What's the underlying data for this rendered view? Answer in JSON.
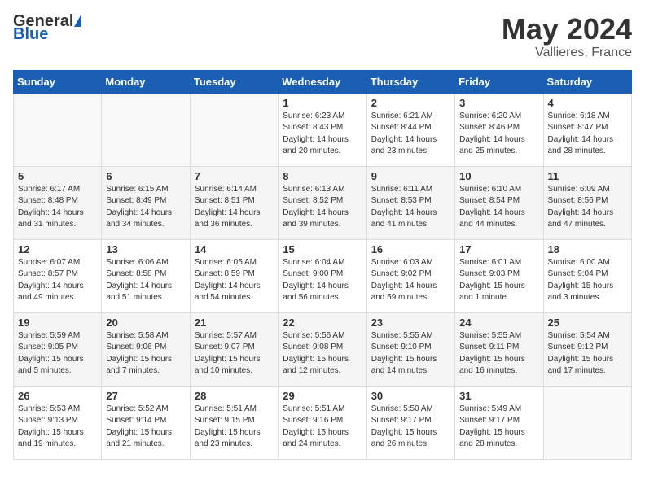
{
  "header": {
    "logo_general": "General",
    "logo_blue": "Blue",
    "title": "May 2024",
    "location": "Vallieres, France"
  },
  "weekdays": [
    "Sunday",
    "Monday",
    "Tuesday",
    "Wednesday",
    "Thursday",
    "Friday",
    "Saturday"
  ],
  "weeks": [
    [
      {
        "day": "",
        "info": ""
      },
      {
        "day": "",
        "info": ""
      },
      {
        "day": "",
        "info": ""
      },
      {
        "day": "1",
        "info": "Sunrise: 6:23 AM\nSunset: 8:43 PM\nDaylight: 14 hours\nand 20 minutes."
      },
      {
        "day": "2",
        "info": "Sunrise: 6:21 AM\nSunset: 8:44 PM\nDaylight: 14 hours\nand 23 minutes."
      },
      {
        "day": "3",
        "info": "Sunrise: 6:20 AM\nSunset: 8:46 PM\nDaylight: 14 hours\nand 25 minutes."
      },
      {
        "day": "4",
        "info": "Sunrise: 6:18 AM\nSunset: 8:47 PM\nDaylight: 14 hours\nand 28 minutes."
      }
    ],
    [
      {
        "day": "5",
        "info": "Sunrise: 6:17 AM\nSunset: 8:48 PM\nDaylight: 14 hours\nand 31 minutes."
      },
      {
        "day": "6",
        "info": "Sunrise: 6:15 AM\nSunset: 8:49 PM\nDaylight: 14 hours\nand 34 minutes."
      },
      {
        "day": "7",
        "info": "Sunrise: 6:14 AM\nSunset: 8:51 PM\nDaylight: 14 hours\nand 36 minutes."
      },
      {
        "day": "8",
        "info": "Sunrise: 6:13 AM\nSunset: 8:52 PM\nDaylight: 14 hours\nand 39 minutes."
      },
      {
        "day": "9",
        "info": "Sunrise: 6:11 AM\nSunset: 8:53 PM\nDaylight: 14 hours\nand 41 minutes."
      },
      {
        "day": "10",
        "info": "Sunrise: 6:10 AM\nSunset: 8:54 PM\nDaylight: 14 hours\nand 44 minutes."
      },
      {
        "day": "11",
        "info": "Sunrise: 6:09 AM\nSunset: 8:56 PM\nDaylight: 14 hours\nand 47 minutes."
      }
    ],
    [
      {
        "day": "12",
        "info": "Sunrise: 6:07 AM\nSunset: 8:57 PM\nDaylight: 14 hours\nand 49 minutes."
      },
      {
        "day": "13",
        "info": "Sunrise: 6:06 AM\nSunset: 8:58 PM\nDaylight: 14 hours\nand 51 minutes."
      },
      {
        "day": "14",
        "info": "Sunrise: 6:05 AM\nSunset: 8:59 PM\nDaylight: 14 hours\nand 54 minutes."
      },
      {
        "day": "15",
        "info": "Sunrise: 6:04 AM\nSunset: 9:00 PM\nDaylight: 14 hours\nand 56 minutes."
      },
      {
        "day": "16",
        "info": "Sunrise: 6:03 AM\nSunset: 9:02 PM\nDaylight: 14 hours\nand 59 minutes."
      },
      {
        "day": "17",
        "info": "Sunrise: 6:01 AM\nSunset: 9:03 PM\nDaylight: 15 hours\nand 1 minute."
      },
      {
        "day": "18",
        "info": "Sunrise: 6:00 AM\nSunset: 9:04 PM\nDaylight: 15 hours\nand 3 minutes."
      }
    ],
    [
      {
        "day": "19",
        "info": "Sunrise: 5:59 AM\nSunset: 9:05 PM\nDaylight: 15 hours\nand 5 minutes."
      },
      {
        "day": "20",
        "info": "Sunrise: 5:58 AM\nSunset: 9:06 PM\nDaylight: 15 hours\nand 7 minutes."
      },
      {
        "day": "21",
        "info": "Sunrise: 5:57 AM\nSunset: 9:07 PM\nDaylight: 15 hours\nand 10 minutes."
      },
      {
        "day": "22",
        "info": "Sunrise: 5:56 AM\nSunset: 9:08 PM\nDaylight: 15 hours\nand 12 minutes."
      },
      {
        "day": "23",
        "info": "Sunrise: 5:55 AM\nSunset: 9:10 PM\nDaylight: 15 hours\nand 14 minutes."
      },
      {
        "day": "24",
        "info": "Sunrise: 5:55 AM\nSunset: 9:11 PM\nDaylight: 15 hours\nand 16 minutes."
      },
      {
        "day": "25",
        "info": "Sunrise: 5:54 AM\nSunset: 9:12 PM\nDaylight: 15 hours\nand 17 minutes."
      }
    ],
    [
      {
        "day": "26",
        "info": "Sunrise: 5:53 AM\nSunset: 9:13 PM\nDaylight: 15 hours\nand 19 minutes."
      },
      {
        "day": "27",
        "info": "Sunrise: 5:52 AM\nSunset: 9:14 PM\nDaylight: 15 hours\nand 21 minutes."
      },
      {
        "day": "28",
        "info": "Sunrise: 5:51 AM\nSunset: 9:15 PM\nDaylight: 15 hours\nand 23 minutes."
      },
      {
        "day": "29",
        "info": "Sunrise: 5:51 AM\nSunset: 9:16 PM\nDaylight: 15 hours\nand 24 minutes."
      },
      {
        "day": "30",
        "info": "Sunrise: 5:50 AM\nSunset: 9:17 PM\nDaylight: 15 hours\nand 26 minutes."
      },
      {
        "day": "31",
        "info": "Sunrise: 5:49 AM\nSunset: 9:17 PM\nDaylight: 15 hours\nand 28 minutes."
      },
      {
        "day": "",
        "info": ""
      }
    ]
  ]
}
